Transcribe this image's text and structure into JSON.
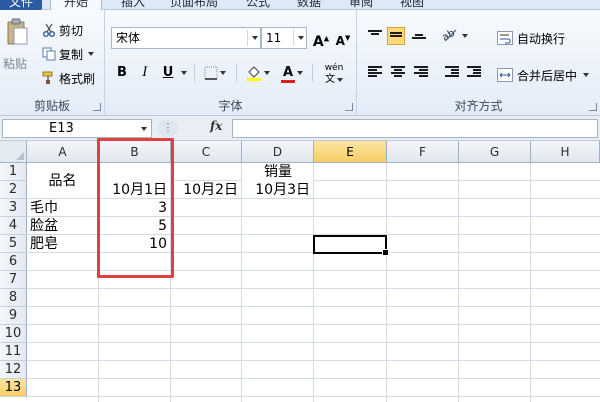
{
  "tabs": {
    "file": "文件",
    "home": "开始",
    "insert": "插入",
    "page_layout": "页面布局",
    "formulas": "公式",
    "data": "数据",
    "review": "审阅",
    "view": "视图"
  },
  "clipboard": {
    "paste": "粘贴",
    "cut": "剪切",
    "copy": "复制",
    "format_painter": "格式刷",
    "group_label": "剪贴板"
  },
  "font": {
    "name": "宋体",
    "size": "11",
    "bold": "B",
    "italic": "I",
    "underline": "U",
    "phonetic": "wén",
    "group_label": "字体"
  },
  "alignment": {
    "wrap_text": "自动换行",
    "merge_center": "合并后居中",
    "group_label": "对齐方式"
  },
  "formula_bar": {
    "name_box": "E13",
    "fx": "fx",
    "formula": ""
  },
  "sheet": {
    "columns": [
      "A",
      "B",
      "C",
      "D",
      "E",
      "F",
      "G",
      "H"
    ],
    "rows": [
      "1",
      "2",
      "3",
      "4",
      "5",
      "6",
      "7",
      "8",
      "9",
      "10",
      "11",
      "12",
      "13"
    ],
    "active_column": "E",
    "active_row": "13",
    "cells": {
      "A1": "品名",
      "D1": "销量",
      "B2": "10月1日",
      "C2": "10月2日",
      "D2": "10月3日",
      "A3": "毛巾",
      "B3": "3",
      "A4": "脸盆",
      "B4": "5",
      "A5": "肥皂",
      "B5": "10"
    }
  },
  "colors": {
    "highlight": "#e2403f",
    "active_header": "#f7cd63",
    "file_tab": "#2b5aa3"
  }
}
